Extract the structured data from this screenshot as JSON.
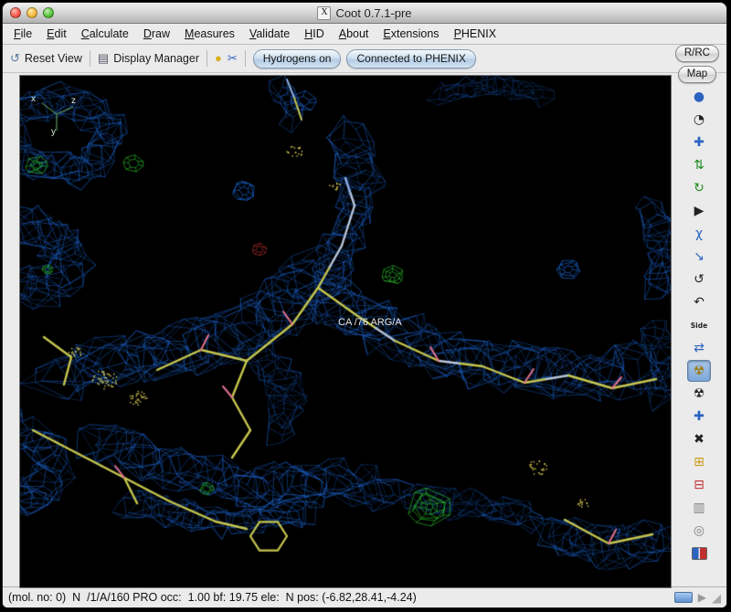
{
  "window": {
    "title": "Coot 0.7.1-pre",
    "app_icon": "X"
  },
  "menubar": {
    "items": [
      "File",
      "Edit",
      "Calculate",
      "Draw",
      "Measures",
      "Validate",
      "HID",
      "About",
      "Extensions",
      "PHENIX"
    ]
  },
  "toolbar": {
    "reset_view": "Reset View",
    "display_manager": "Display Manager",
    "hydrogens": "Hydrogens on",
    "phenix": "Connected to PHENIX",
    "icons": [
      {
        "name": "reset-view-icon",
        "glyph": "↺"
      },
      {
        "name": "display-manager-icon",
        "glyph": "▤"
      },
      {
        "name": "label-atom-icon",
        "glyph": "●"
      },
      {
        "name": "measure-icon",
        "glyph": "✂"
      }
    ]
  },
  "side_buttons": {
    "rrc": "R/RC",
    "map": "Map"
  },
  "sidebar": {
    "side_label": "Side",
    "icons": [
      {
        "name": "sphere-icon",
        "glyph": "●"
      },
      {
        "name": "clock-icon",
        "glyph": "◔"
      },
      {
        "name": "move-icon",
        "glyph": "✚"
      },
      {
        "name": "updown-arrows-icon",
        "glyph": "⇅"
      },
      {
        "name": "rotate-icon",
        "glyph": "↻"
      },
      {
        "name": "play-icon",
        "glyph": "▶"
      },
      {
        "name": "torsion-icon",
        "glyph": "χ"
      },
      {
        "name": "jump-arrow-icon",
        "glyph": "↘"
      },
      {
        "name": "refresh-icon",
        "glyph": "↺"
      },
      {
        "name": "undo-icon",
        "glyph": "↶"
      },
      {
        "name": "side-chain-icon",
        "glyph": "Side"
      },
      {
        "name": "flip-icon",
        "glyph": "⇄"
      },
      {
        "name": "radiation-icon",
        "glyph": "☢"
      },
      {
        "name": "radiation-dark-icon",
        "glyph": "☢"
      },
      {
        "name": "add-atom-icon",
        "glyph": "✚"
      },
      {
        "name": "delete-icon",
        "glyph": "✖"
      },
      {
        "name": "add-box-icon",
        "glyph": "⊞"
      },
      {
        "name": "remove-box-icon",
        "glyph": "⊟"
      },
      {
        "name": "trash-icon",
        "glyph": "▥"
      },
      {
        "name": "circle-icon",
        "glyph": "◎"
      },
      {
        "name": "flag-icon",
        "glyph": ""
      }
    ]
  },
  "viewport": {
    "atom_label": "CA /76 ARG/A",
    "axis_x": "x",
    "axis_y": "y",
    "axis_z": "z"
  },
  "statusbar": {
    "text": "(mol. no: 0)  N  /1/A/160 PRO occ:  1.00 bf: 19.75 ele:  N pos: (-6.82,28.41,-4.24)"
  },
  "colors": {
    "mesh_blue": "#1f6fe5",
    "model_yellow": "#c6c64f",
    "model_light": "#b9c6dd",
    "model_pale": "#8fb0e8",
    "oxy_pink": "#e0708c",
    "diff_green": "#2ecc2e",
    "diff_red": "#cc3333",
    "dots_yellow": "#d4c452",
    "axis_green": "#7cc77c"
  }
}
